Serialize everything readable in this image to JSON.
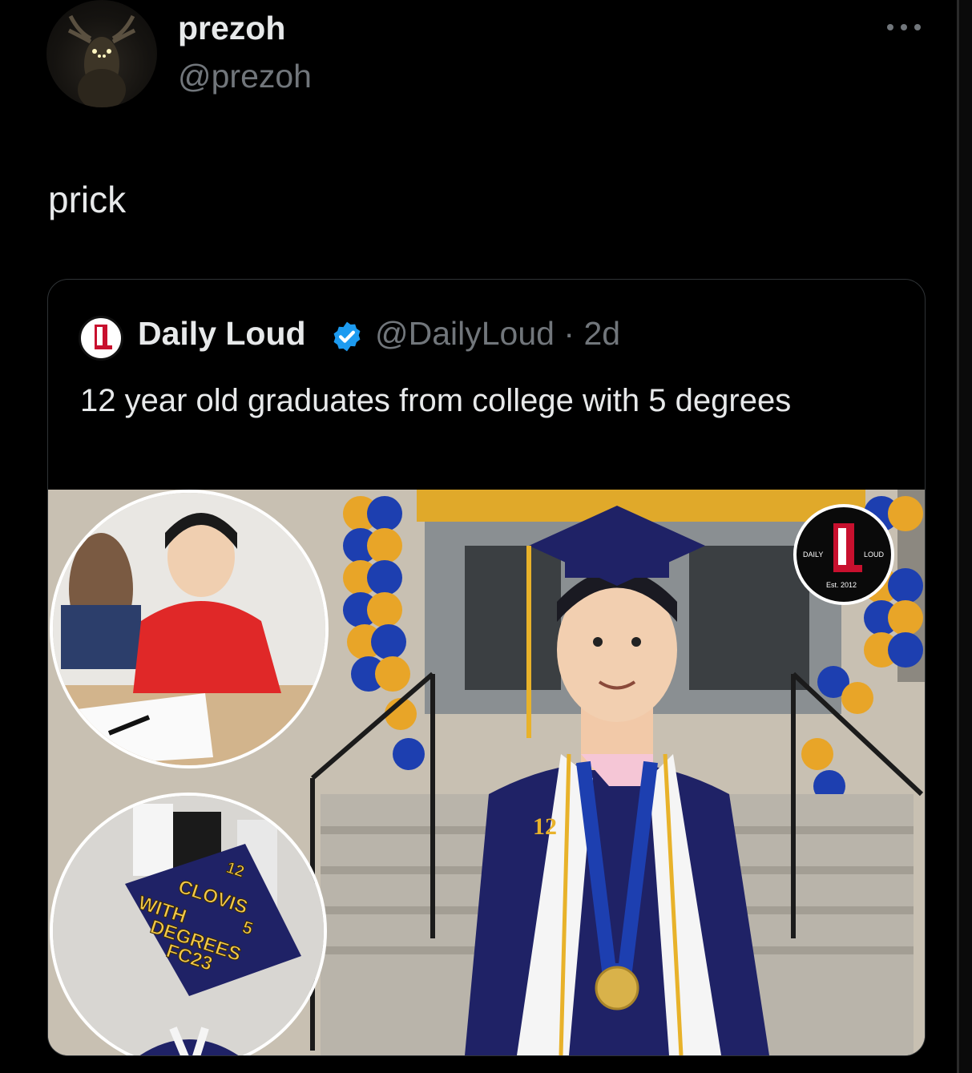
{
  "author": {
    "name": "prezoh",
    "handle": "@prezoh"
  },
  "tweet": {
    "text": "prick"
  },
  "quoted": {
    "name": "Daily Loud",
    "handle": "@DailyLoud",
    "separator": "·",
    "time": "2d",
    "text": "12 year old graduates from college with 5 degrees",
    "logo_text": {
      "left": "DAILY",
      "right": "LOUD",
      "est": "Est. 2012"
    },
    "cap_text": [
      "12",
      "CLOVIS",
      "WITH",
      "5",
      "DEGREES",
      "FC23"
    ],
    "stole_text": "12 CLOVIS"
  },
  "icons": {
    "more": "more-dots-icon",
    "verified": "verified-badge-icon"
  },
  "colors": {
    "background": "#000000",
    "text": "#e7e9ea",
    "secondary": "#71767b",
    "border": "#2f3336",
    "verified": "#1d9bf0",
    "gown": "#1f2266",
    "gold": "#e8b22a"
  }
}
